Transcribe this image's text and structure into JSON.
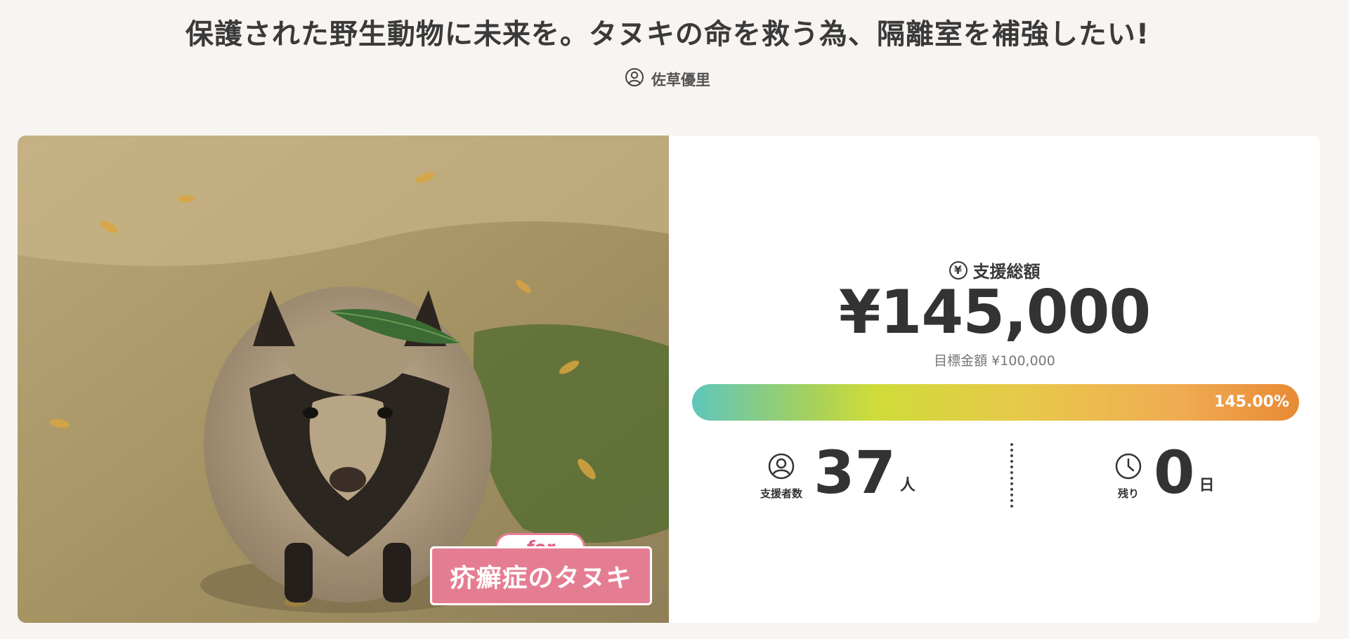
{
  "header": {
    "title": "保護された野生動物に未来を。タヌキの命を救う為、隔離室を補強したい!",
    "author": "佐草優里",
    "author_icon": "user-circle-icon"
  },
  "photo": {
    "for_label": "for",
    "subject_label": "疥癬症のタヌキ"
  },
  "funding": {
    "total_label": "支援総額",
    "total_icon": "yen-circle-icon",
    "total_amount": "¥145,000",
    "goal_text": "目標金額 ¥100,000",
    "progress_fraction": 1.0,
    "progress_text": "145.00%",
    "supporters_label": "支援者数",
    "supporters_icon": "user-circle-icon",
    "supporters_count": "37",
    "supporters_unit": "人",
    "remaining_label": "残り",
    "remaining_icon": "clock-icon",
    "remaining_days": "0",
    "remaining_unit": "日"
  },
  "colors": {
    "background": "#f8f4f1",
    "tag_pink": "#e57d92",
    "progress_start": "#5ec6bc",
    "progress_end": "#e88a35"
  }
}
